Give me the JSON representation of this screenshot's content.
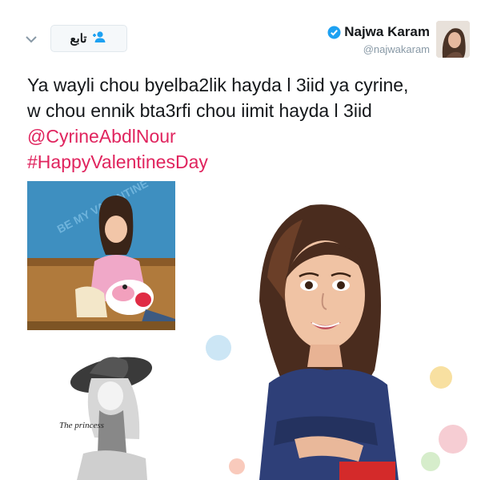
{
  "tweet": {
    "follow_label": "تابع",
    "author_name": "Najwa Karam",
    "author_handle": "@najwakaram",
    "text_lines": [
      "Ya wayli chou byelba2lik hayda l 3iid ya cyrine,",
      "w chou ennik bta3rfi chou iimit hayda l 3iid"
    ],
    "mention": "@CyrineAbdlNour",
    "hashtag": "#HappyValentinesDay"
  },
  "media": {
    "img1_text": "BE MY VALENTINE",
    "img2_text": "The princess"
  },
  "colors": {
    "link": "#e0245e",
    "verified": "#1da1f2",
    "follow_icon": "#1da1f2"
  },
  "icons": {
    "dropdown": "chevron-down-icon",
    "follow": "add-user-icon",
    "verified": "verified-badge-icon"
  }
}
